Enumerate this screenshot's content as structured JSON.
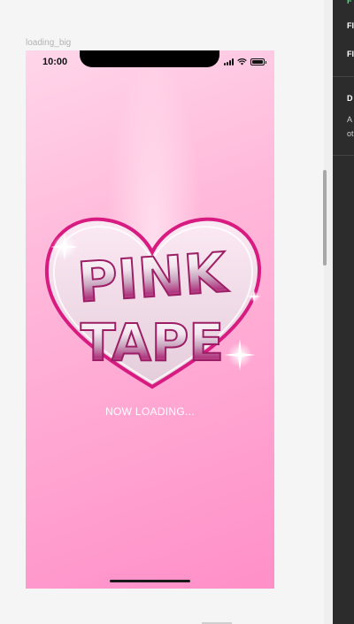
{
  "frame": {
    "label": "loading_big"
  },
  "status_bar": {
    "time": "10:00"
  },
  "logo": {
    "line1": "PINK",
    "line2": "TAPE"
  },
  "loading": {
    "text": "NOW LOADING..."
  },
  "panel": {
    "top_accent": "F",
    "row1": "Fl",
    "row2": "Fl",
    "row3": "D",
    "desc1": "A",
    "desc2": "ot"
  },
  "colors": {
    "pink_bg": "#ffa6d2",
    "magenta": "#e0308f",
    "panel_bg": "#2c2c2c"
  }
}
